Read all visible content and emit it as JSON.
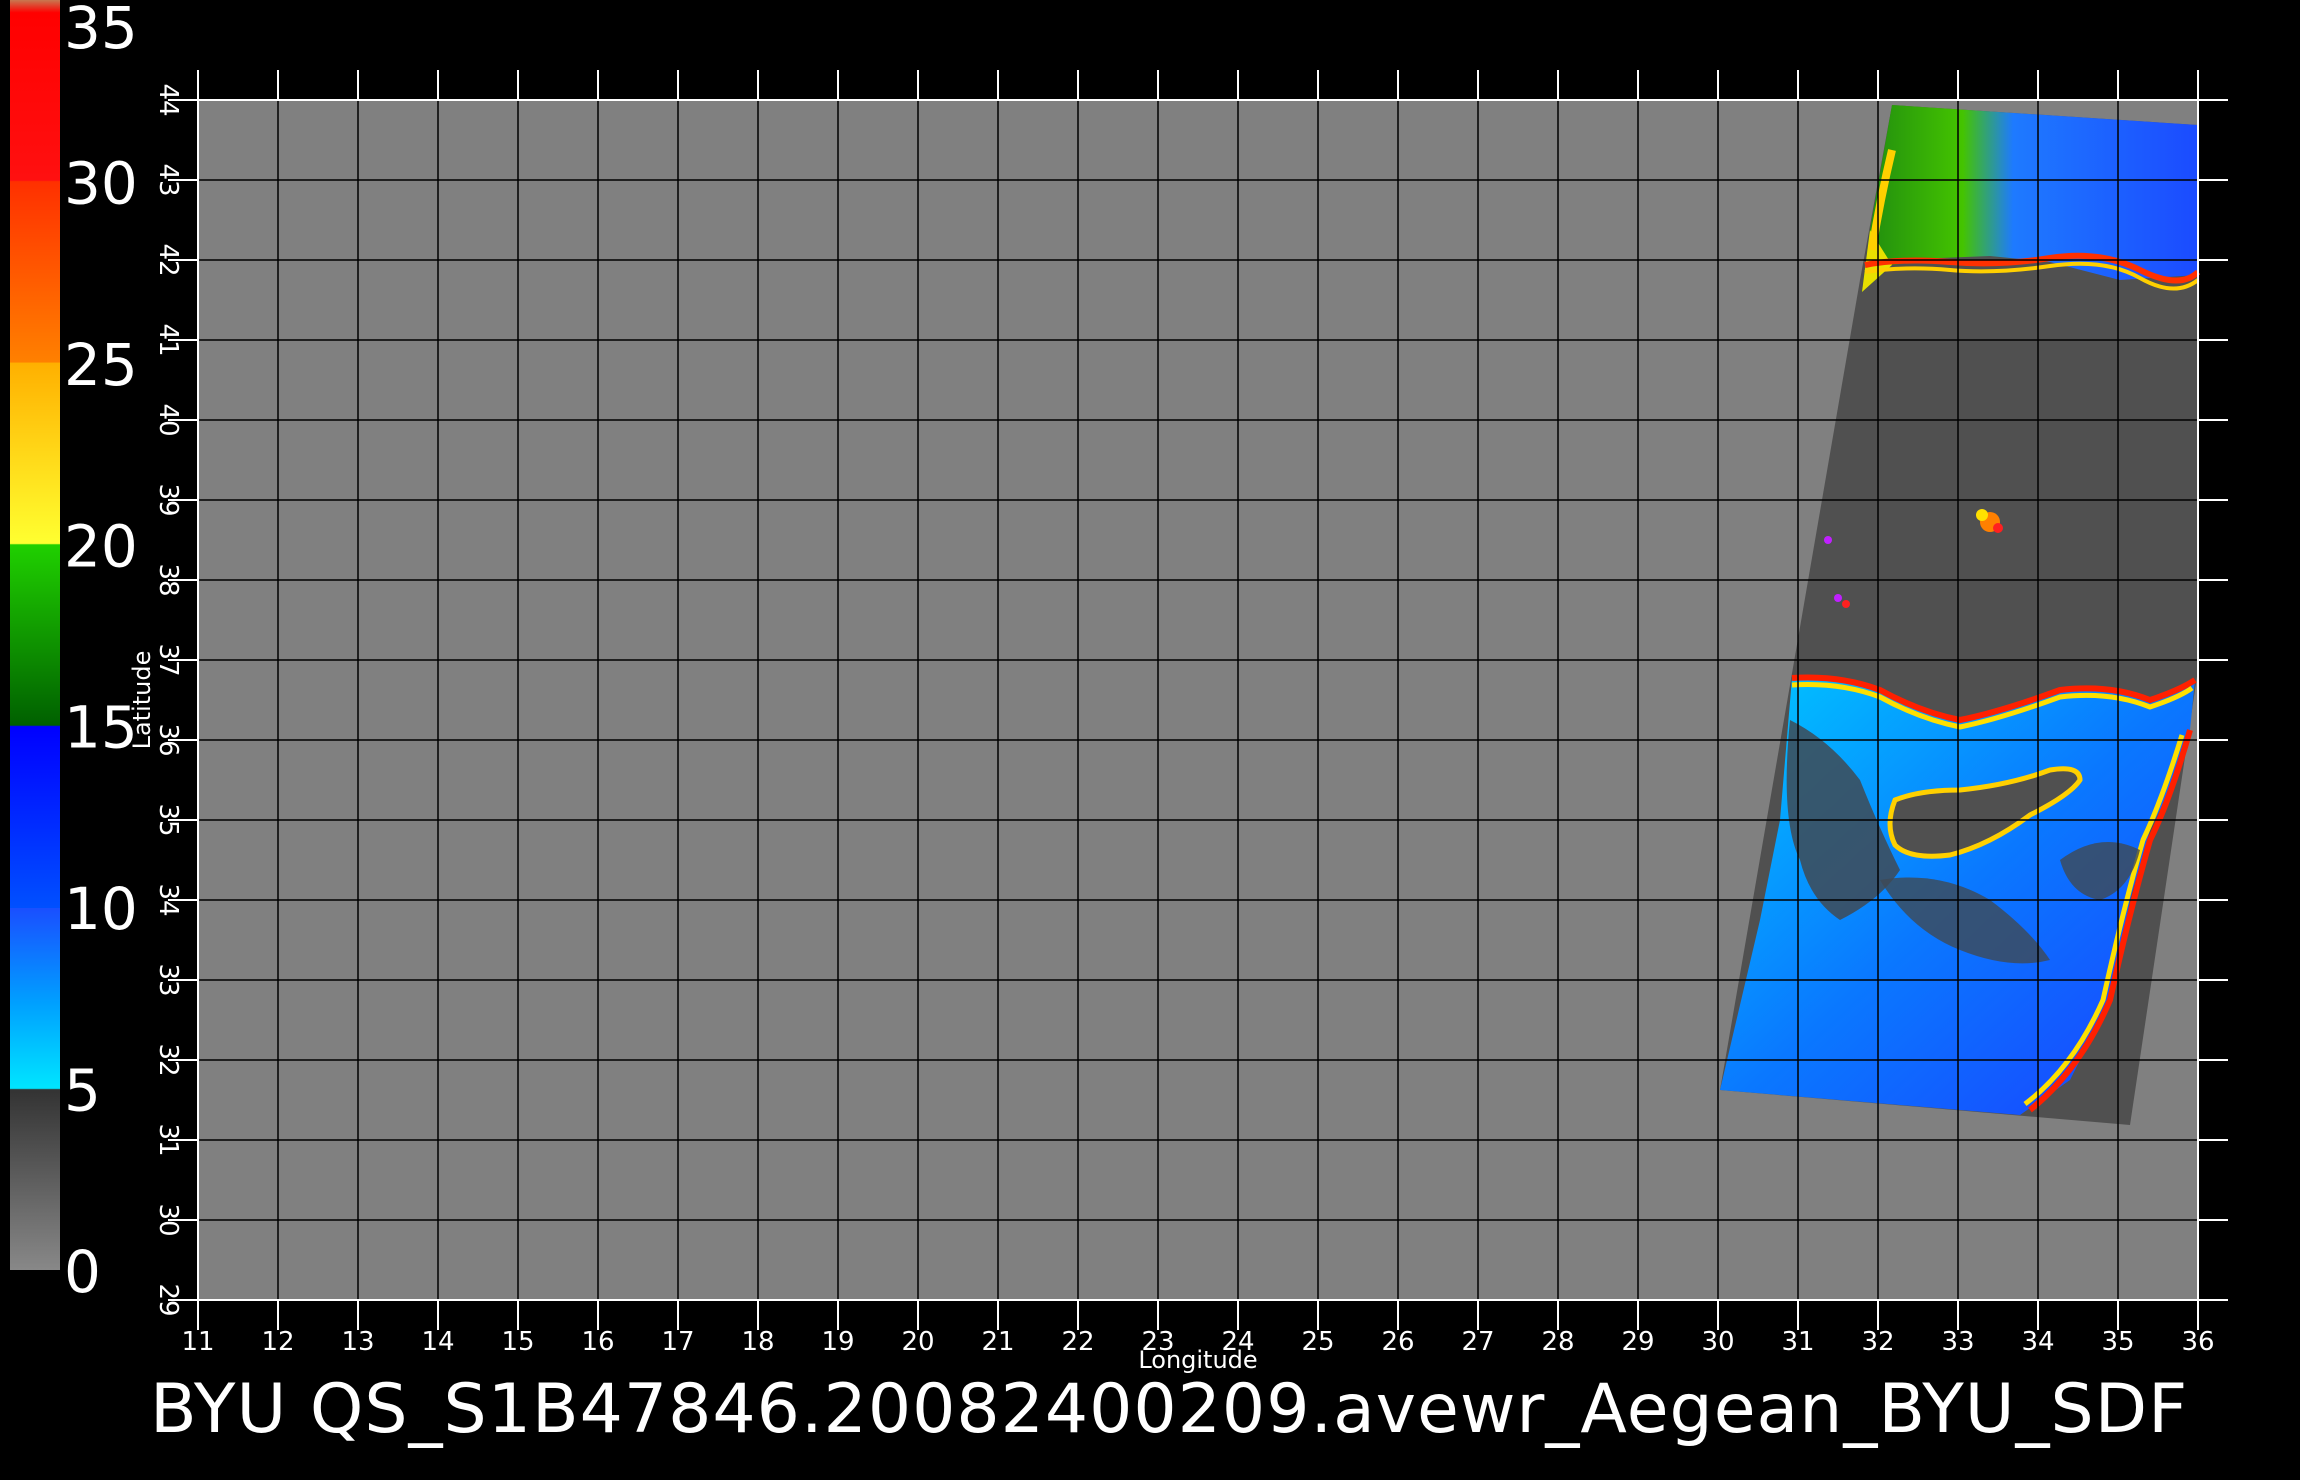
{
  "footer": {
    "title": "BYU  QS_S1B47846.20082400209.avewr_Aegean_BYU_SDF"
  },
  "axes": {
    "xlabel": "Longitude",
    "ylabel": "Latitude",
    "lon_ticks": [
      "11",
      "12",
      "13",
      "14",
      "15",
      "16",
      "17",
      "18",
      "19",
      "20",
      "21",
      "22",
      "23",
      "24",
      "25",
      "26",
      "27",
      "28",
      "29",
      "30",
      "31",
      "32",
      "33",
      "34",
      "35",
      "36"
    ],
    "lat_ticks": [
      "29",
      "30",
      "31",
      "32",
      "33",
      "34",
      "35",
      "36",
      "37",
      "38",
      "39",
      "40",
      "41",
      "42",
      "43",
      "44"
    ],
    "lon_range": [
      11,
      36
    ],
    "lat_range": [
      29,
      44
    ]
  },
  "colorbar": {
    "ticks": [
      "0",
      "5",
      "10",
      "15",
      "20",
      "25",
      "30",
      "35"
    ],
    "range": [
      0,
      35
    ],
    "colors": {
      "0-5": "#4a4a4a",
      "5-10": "#00e5ff",
      "10-15": "#1a4fff",
      "15-20": "#00b000",
      "20-25": "#ffe000",
      "25-30": "#ff6a00",
      "30-35": "#ff2020",
      "35+": "#c87850"
    }
  },
  "map": {
    "background_color": "#808080",
    "swath_color": "#505050",
    "grid_color": "#000000"
  }
}
